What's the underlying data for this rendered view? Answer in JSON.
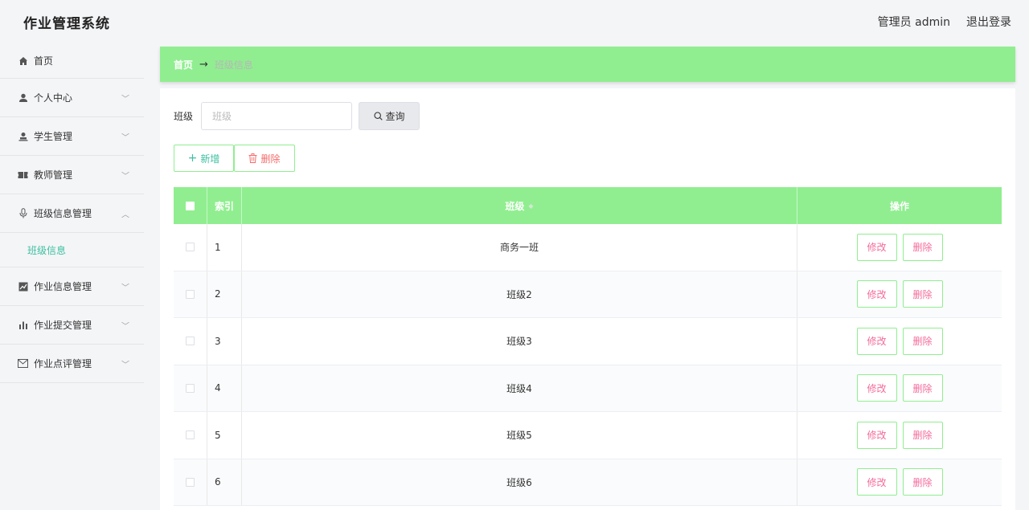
{
  "app": {
    "title": "作业管理系统"
  },
  "header": {
    "user": "管理员 admin",
    "logout": "退出登录"
  },
  "sidebar": {
    "items": [
      {
        "label": "首页"
      },
      {
        "label": "个人中心"
      },
      {
        "label": "学生管理"
      },
      {
        "label": "教师管理"
      },
      {
        "label": "班级信息管理"
      },
      {
        "label": "作业信息管理"
      },
      {
        "label": "作业提交管理"
      },
      {
        "label": "作业点评管理"
      }
    ],
    "submenu": {
      "label": "班级信息"
    }
  },
  "breadcrumb": {
    "home": "首页",
    "arrow": "→",
    "current": "班级信息"
  },
  "search": {
    "label": "班级",
    "placeholder": "班级",
    "button": "查询"
  },
  "actions": {
    "add": "新增",
    "delete": "删除"
  },
  "table": {
    "headers": {
      "index": "索引",
      "name": "班级",
      "ops": "操作"
    },
    "rows": [
      {
        "index": "1",
        "name": "商务一班"
      },
      {
        "index": "2",
        "name": "班级2"
      },
      {
        "index": "3",
        "name": "班级3"
      },
      {
        "index": "4",
        "name": "班级4"
      },
      {
        "index": "5",
        "name": "班级5"
      },
      {
        "index": "6",
        "name": "班级6"
      }
    ],
    "row_actions": {
      "edit": "修改",
      "delete": "删除"
    }
  },
  "colors": {
    "accent": "#90ee90",
    "teal": "#3cc0a0",
    "danger": "#f56c6c"
  }
}
